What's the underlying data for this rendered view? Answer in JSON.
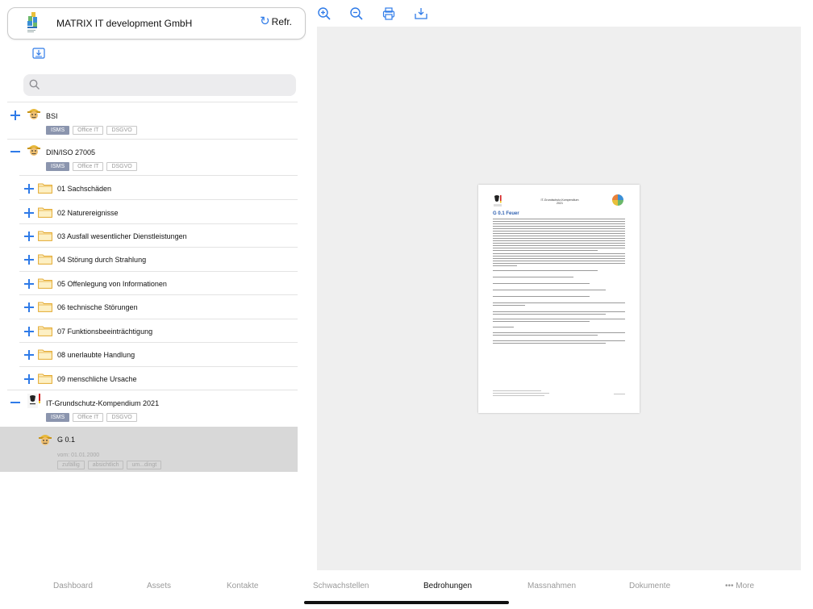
{
  "header": {
    "company": "MATRIX IT development GmbH",
    "refresh_label": "Refr."
  },
  "search": {
    "placeholder": ""
  },
  "tree": {
    "tag_labels": [
      "ISMS",
      "Office IT",
      "DSGVO"
    ],
    "nodes": [
      {
        "label": "BSI",
        "expanded": false
      },
      {
        "label": "DIN/ISO 27005",
        "expanded": true
      },
      {
        "label": "01 Sachschäden"
      },
      {
        "label": "02 Naturereignisse"
      },
      {
        "label": "03 Ausfall wesentlicher Dienstleistungen"
      },
      {
        "label": "04 Störung durch Strahlung"
      },
      {
        "label": "05 Offenlegung von Informationen"
      },
      {
        "label": "06 technische Störungen"
      },
      {
        "label": "07 Funktionsbeeinträchtigung"
      },
      {
        "label": "08 unerlaubte Handlung"
      },
      {
        "label": "09 menschliche Ursache"
      },
      {
        "label": "IT-Grundschutz-Kompendium 2021",
        "expanded": true
      }
    ],
    "selected": {
      "label": "G 0.1",
      "date": "vom: 01.01.2000",
      "tags": [
        "zufällig",
        "absichtlich",
        "um...dingt"
      ]
    }
  },
  "document": {
    "header_text_line1": "IT-Grundschutz-Kompendium",
    "header_text_line2": "2021",
    "title": "G 0.1 Feuer"
  },
  "tabs": [
    {
      "label": "Dashboard"
    },
    {
      "label": "Assets"
    },
    {
      "label": "Kontakte"
    },
    {
      "label": "Schwachstellen"
    },
    {
      "label": "Bedrohungen",
      "active": true
    },
    {
      "label": "Massnahmen"
    },
    {
      "label": "Dokumente"
    },
    {
      "label": "••• More"
    }
  ],
  "colors": {
    "accent": "#2f7be8",
    "tag_active": "#8b95ae",
    "selected_row": "#d8d8d8",
    "viewer_bg": "#efefef"
  }
}
